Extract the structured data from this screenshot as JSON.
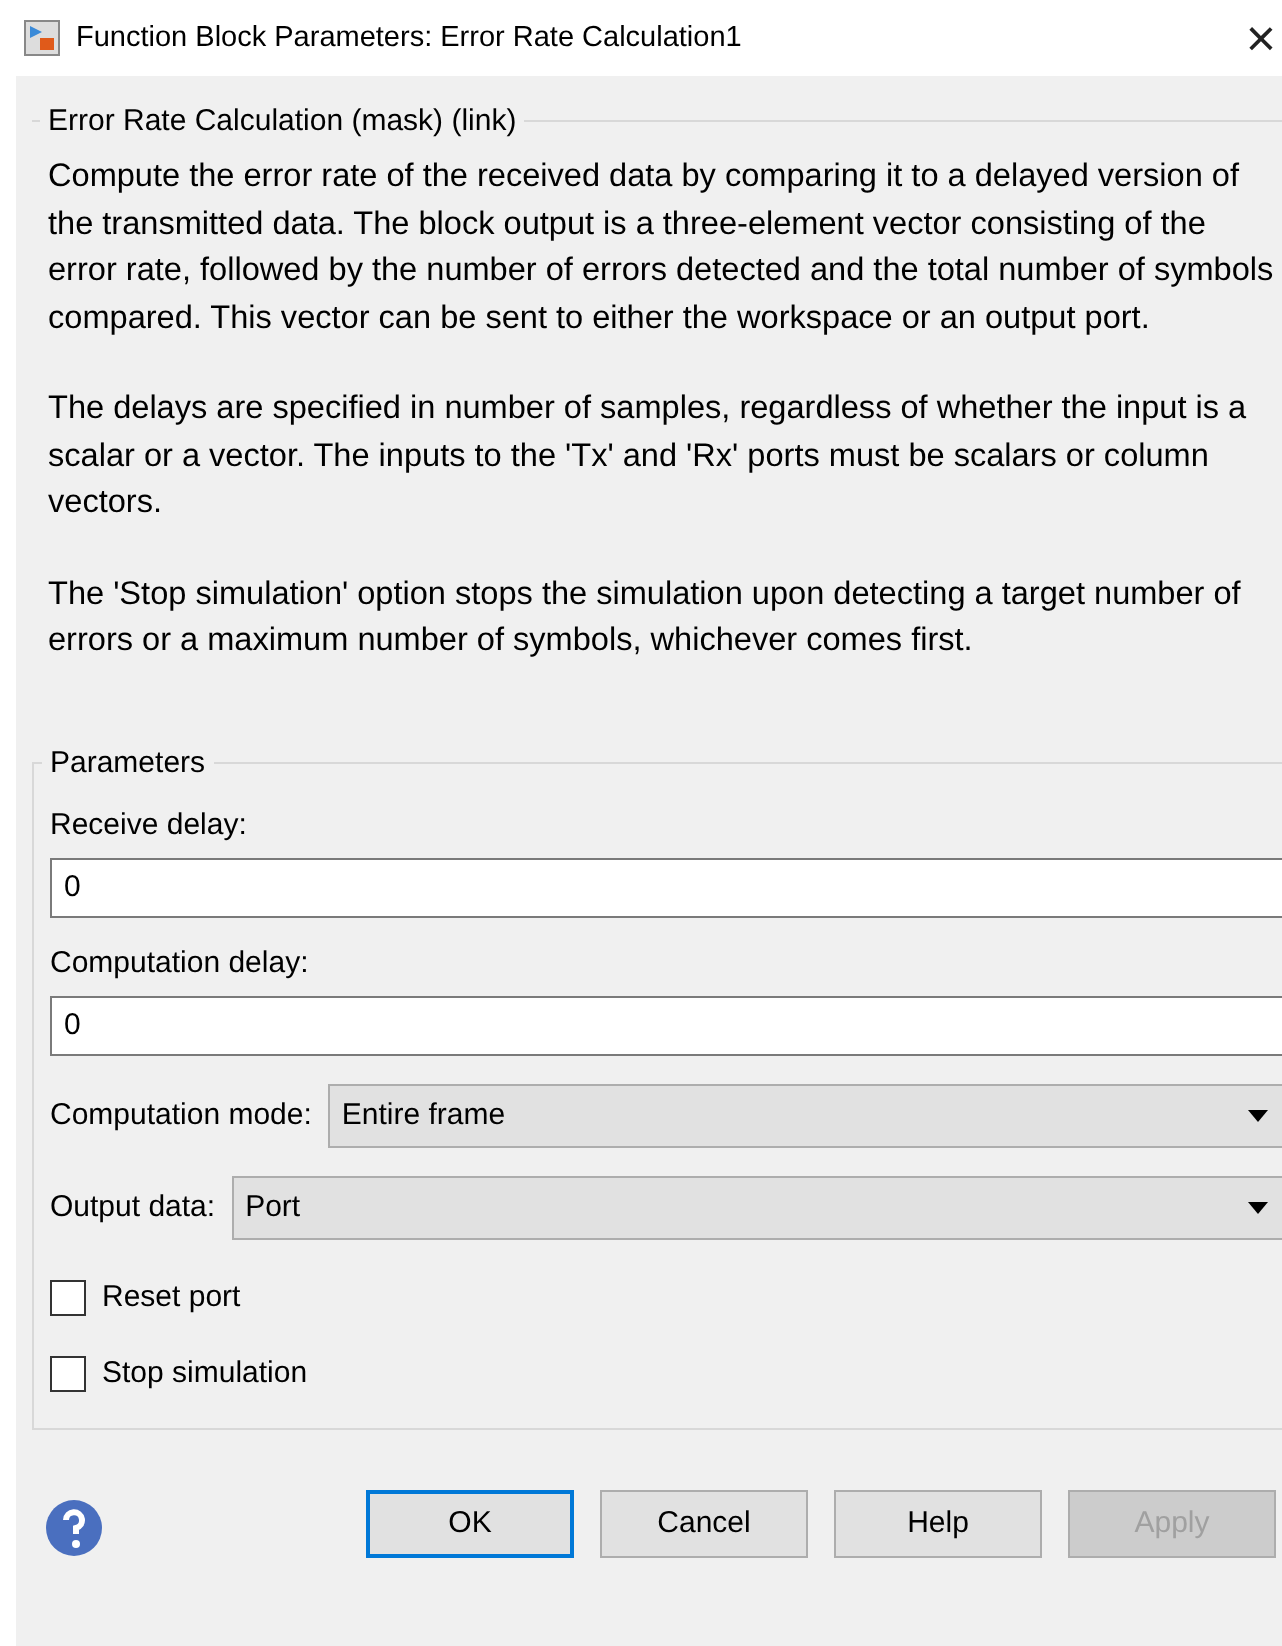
{
  "window": {
    "title": "Function Block Parameters: Error Rate Calculation1",
    "close": "×"
  },
  "description": {
    "title": "Error Rate Calculation (mask) (link)",
    "paragraphs": [
      "Compute the error rate of the received data by comparing it to a delayed version of the transmitted data. The block output is a three-element vector consisting of the error rate, followed by the number of errors detected and the total number of symbols compared. This vector can be sent to either the workspace or an output port.",
      "The delays are specified in number of samples, regardless of whether the input is a scalar or a vector. The inputs to the 'Tx' and 'Rx' ports must be scalars or column vectors.",
      "The 'Stop simulation' option stops the simulation upon detecting a target number of errors or a maximum number of symbols, whichever comes first."
    ]
  },
  "parameters": {
    "title": "Parameters",
    "items": [
      {
        "kind": "text",
        "label": "Receive delay:",
        "value": "0"
      },
      {
        "kind": "text",
        "label": "Computation delay:",
        "value": "0"
      },
      {
        "kind": "select",
        "label": "Computation mode:",
        "value": "Entire frame"
      },
      {
        "kind": "select",
        "label": "Output data:",
        "value": "Port"
      },
      {
        "kind": "checkbox",
        "label": "Reset port",
        "checked": false
      },
      {
        "kind": "checkbox",
        "label": "Stop simulation",
        "checked": false
      }
    ]
  },
  "buttons": [
    {
      "label": "OK",
      "default": true,
      "disabled": false
    },
    {
      "label": "Cancel",
      "default": false,
      "disabled": false
    },
    {
      "label": "Help",
      "default": false,
      "disabled": false
    },
    {
      "label": "Apply",
      "default": false,
      "disabled": true
    }
  ]
}
